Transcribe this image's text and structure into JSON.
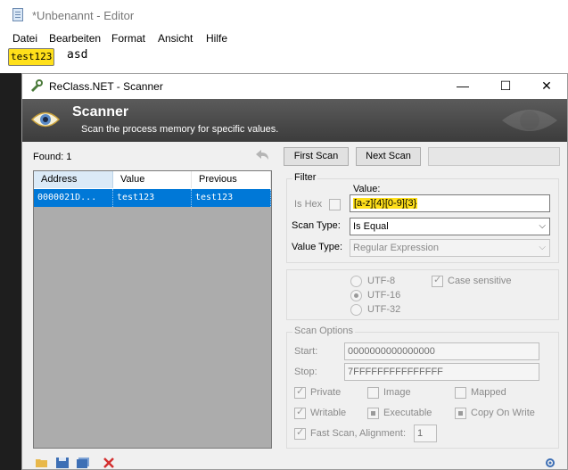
{
  "notepad": {
    "title": "*Unbenannt - Editor",
    "menu": [
      "Datei",
      "Bearbeiten",
      "Format",
      "Ansicht",
      "Hilfe"
    ],
    "selected_text": "test123",
    "rest_text": "asd"
  },
  "scanner": {
    "window_title": "ReClass.NET - Scanner",
    "controls": {
      "minimize": "—",
      "maximize": "☐",
      "close": "✕"
    },
    "banner_title": "Scanner",
    "banner_subtitle": "Scan the process memory for specific values.",
    "found_label": "Found: 1",
    "columns": [
      "Address",
      "Value",
      "Previous"
    ],
    "rows": [
      {
        "address": "0000021D...",
        "value": "test123",
        "previous": "test123"
      }
    ],
    "first_scan": "First Scan",
    "next_scan": "Next Scan",
    "filter": {
      "legend": "Filter",
      "is_hex": "Is Hex",
      "value_label": "Value:",
      "value": "[a-z]{4}[0-9]{3}",
      "scan_type_label": "Scan Type:",
      "scan_type": "Is Equal",
      "value_type_label": "Value Type:",
      "value_type": "Regular Expression"
    },
    "encoding": {
      "utf8": "UTF-8",
      "utf16": "UTF-16",
      "utf32": "UTF-32",
      "case_sensitive": "Case sensitive"
    },
    "scan_options": {
      "legend": "Scan Options",
      "start_label": "Start:",
      "start": "0000000000000000",
      "stop_label": "Stop:",
      "stop": "7FFFFFFFFFFFFFFF",
      "private": "Private",
      "image": "Image",
      "mapped": "Mapped",
      "writable": "Writable",
      "executable": "Executable",
      "copy_on_write": "Copy On Write",
      "fast_scan": "Fast Scan, Alignment:",
      "alignment": "1"
    },
    "colors": {
      "accent": "#0078d7",
      "banner": "#4a4a4a",
      "highlight": "#ffe01a"
    }
  }
}
